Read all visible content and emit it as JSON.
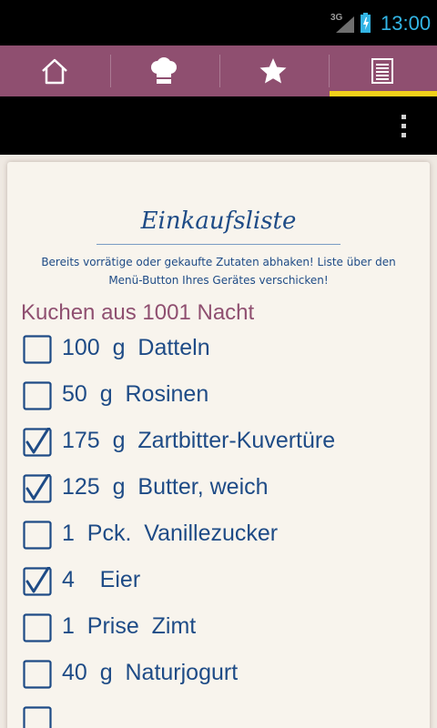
{
  "status_bar": {
    "network": "3G",
    "time": "13:00"
  },
  "tabs": [
    {
      "name": "home",
      "icon": "home-icon"
    },
    {
      "name": "recipes",
      "icon": "chef-hat-icon"
    },
    {
      "name": "favorites",
      "icon": "star-icon"
    },
    {
      "name": "shopping-list",
      "icon": "list-icon",
      "selected": true
    }
  ],
  "page": {
    "title": "Einkaufsliste",
    "subtitle_line1": "Bereits vorrätige oder gekaufte Zutaten abhaken! Liste über den",
    "subtitle_line2": "Menü-Button Ihres Gerätes verschicken!",
    "recipe": "Kuchen aus 1001 Nacht"
  },
  "items": [
    {
      "text": "100  g  Datteln",
      "checked": false
    },
    {
      "text": "50  g  Rosinen",
      "checked": false
    },
    {
      "text": "175  g  Zartbitter-Kuvertüre",
      "checked": true
    },
    {
      "text": "125  g  Butter, weich",
      "checked": true
    },
    {
      "text": "1  Pck.  Vanillezucker",
      "checked": false
    },
    {
      "text": "4    Eier",
      "checked": true
    },
    {
      "text": "1  Prise  Zimt",
      "checked": false
    },
    {
      "text": "40  g  Naturjogurt",
      "checked": false
    }
  ],
  "colors": {
    "tabbar": "#8f4f70",
    "indicator": "#f2d11a",
    "text_blue": "#1e4b86",
    "recipe_purple": "#8f4f70",
    "clock": "#33b5e5"
  }
}
